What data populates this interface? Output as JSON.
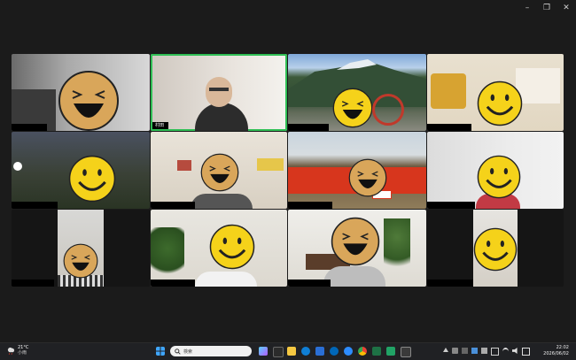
{
  "window": {
    "controls": {
      "minimize": "–",
      "maximize": "❐",
      "close": "✕"
    }
  },
  "participants": [
    {
      "name": "",
      "active": false
    },
    {
      "name": "村田",
      "active": true
    },
    {
      "name": "",
      "active": false
    },
    {
      "name": "",
      "active": false
    },
    {
      "name": "",
      "active": false
    },
    {
      "name": "",
      "active": false
    },
    {
      "name": "",
      "active": false
    },
    {
      "name": "",
      "active": false
    },
    {
      "name": "",
      "active": false
    },
    {
      "name": "",
      "active": false
    },
    {
      "name": "",
      "active": false
    },
    {
      "name": "",
      "active": false
    }
  ],
  "taskbar": {
    "weather_temp": "21°C",
    "weather_desc": "小雨",
    "search_placeholder": "検索",
    "time": "22:02",
    "date": "2026/06/02"
  },
  "colors": {
    "active_outline": "#2fbf55",
    "smiley": "#f5d21a",
    "laugh": "#d9a65a"
  }
}
